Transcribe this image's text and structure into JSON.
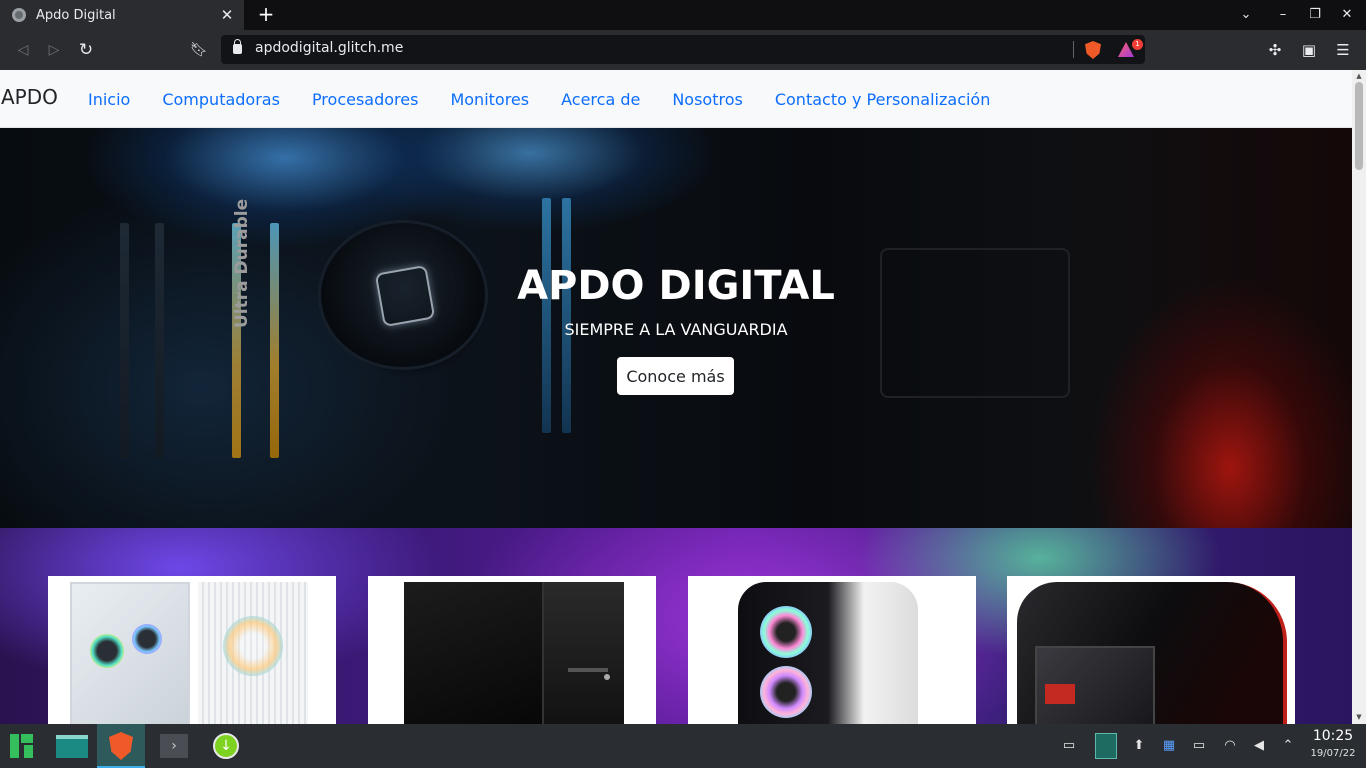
{
  "browser": {
    "tab_title": "Apdo Digital",
    "tab_close": "✕",
    "new_tab": "+",
    "url": "apdodigital.glitch.me",
    "rewards_badge": "1",
    "icons": {
      "favicon": "globe-icon",
      "back": "back-icon",
      "forward": "forward-icon",
      "reload": "reload-icon",
      "bookmark": "bookmark-icon",
      "lock": "lock-icon",
      "brave_shields": "brave-shields-icon",
      "brave_rewards": "brave-rewards-icon",
      "extensions": "puzzle-icon",
      "wallet": "wallet-icon",
      "menu": "hamburger-menu-icon"
    }
  },
  "site": {
    "brand": "APDO",
    "nav": [
      "Inicio",
      "Computadoras",
      "Procesadores",
      "Monitores",
      "Acerca de",
      "Nosotros",
      "Contacto y Personalización"
    ],
    "hero": {
      "title": "APDO DIGITAL",
      "subtitle": "SIEMPRE A LA VANGUARDIA",
      "button": "Conoce más",
      "image_text": "Ultra Durable"
    },
    "link_color": "#0d6efd"
  },
  "taskbar": {
    "time": "10:25",
    "date": "19/07/22",
    "apps": [
      "manjaro-menu-icon",
      "file-manager-icon",
      "brave-browser-icon",
      "terminal-icon",
      "download-manager-icon"
    ],
    "tray": [
      "show-desktop-icon",
      "pager-icon",
      "updates-icon",
      "clipboard-icon",
      "battery-icon",
      "wifi-icon",
      "volume-icon",
      "tray-expand-icon"
    ]
  }
}
